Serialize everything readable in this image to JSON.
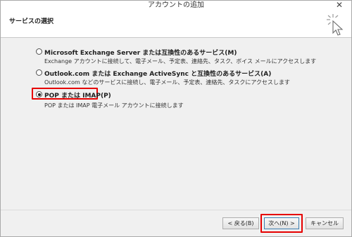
{
  "window": {
    "title": "アカウントの追加",
    "close_glyph": "✕"
  },
  "header": {
    "title": "サービスの選択",
    "icon": "cursor-click-icon"
  },
  "options": [
    {
      "label": "Microsoft Exchange Server または互換性のあるサービス(M)",
      "description": "Exchange アカウントに接続して、電子メール、予定表、連絡先、タスク、ボイス メールにアクセスします",
      "selected": false
    },
    {
      "label": "Outlook.com または Exchange ActiveSync と互換性のあるサービス(A)",
      "description": "Outlook.com などのサービスに接続し、電子メール、予定表、連絡先、タスクにアクセスします",
      "selected": false
    },
    {
      "label": "POP または IMAP(P)",
      "description": "POP または IMAP 電子メール アカウントに接続します",
      "selected": true
    }
  ],
  "buttons": {
    "back": "< 戻る(B)",
    "next": "次へ(N) >",
    "cancel": "キャンセル"
  },
  "colors": {
    "highlight": "#e60000",
    "dialog_bg": "#f0f0f0",
    "header_bg": "#ffffff"
  }
}
